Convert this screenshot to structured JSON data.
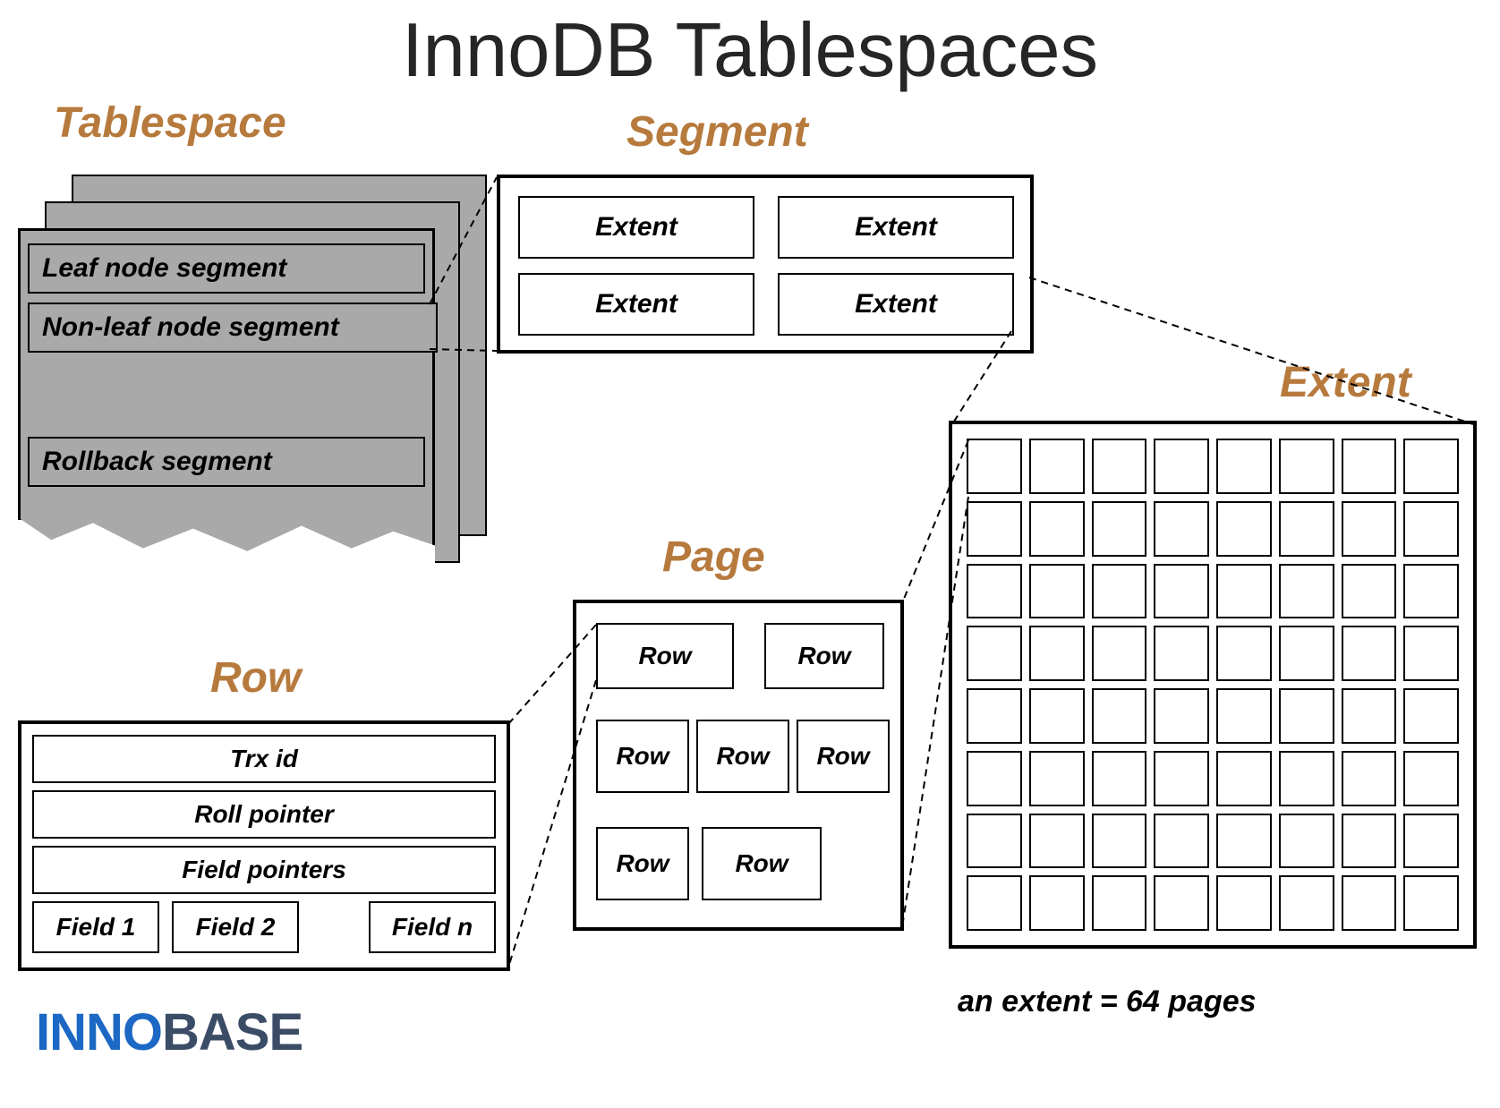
{
  "title": "InnoDB Tablespaces",
  "labels": {
    "tablespace": "Tablespace",
    "segment": "Segment",
    "extent": "Extent",
    "page": "Page",
    "row": "Row"
  },
  "tablespace_segments": {
    "leaf": "Leaf node segment",
    "nonleaf": "Non-leaf node segment",
    "rollback": "Rollback segment"
  },
  "segment_cells": [
    "Extent",
    "Extent",
    "Extent",
    "Extent"
  ],
  "extent_grid": {
    "cols": 8,
    "rows": 8
  },
  "page_rows": [
    "Row",
    "Row",
    "Row",
    "Row",
    "Row",
    "Row",
    "Row"
  ],
  "row_fields": {
    "trx": "Trx id",
    "roll": "Roll pointer",
    "ptrs": "Field pointers",
    "fields": [
      "Field 1",
      "Field 2",
      "Field n"
    ]
  },
  "footnote": "an extent = 64 pages",
  "logo": {
    "a": "INNO",
    "b": "BASE"
  }
}
